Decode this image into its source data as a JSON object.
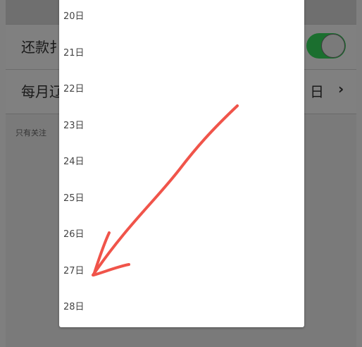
{
  "settings": {
    "rows": [
      {
        "label": "还款提醒",
        "visible_label": "还款扌"
      },
      {
        "label": "每月还款日",
        "visible_label": "每月辽",
        "value": "日",
        "chevron": "›"
      }
    ],
    "toggle_on": true,
    "hint_visible": "只有关注",
    "accent_color": "#4caf50"
  },
  "picker": {
    "days": [
      "20日",
      "21日",
      "22日",
      "23日",
      "24日",
      "25日",
      "26日",
      "27日",
      "28日"
    ]
  },
  "annotation": {
    "color": "#f0544a",
    "icon": "arrow-icon"
  }
}
